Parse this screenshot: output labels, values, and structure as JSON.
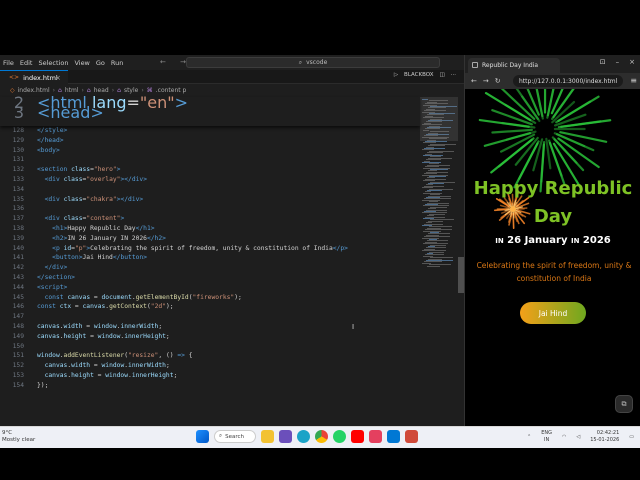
{
  "menu": [
    "File",
    "Edit",
    "Selection",
    "View",
    "Go",
    "Run"
  ],
  "nav_arrows": "← →",
  "command_center": {
    "text": "vscode"
  },
  "editor_tab": {
    "label": "index.html",
    "icon_text": "<>"
  },
  "editor_actions": {
    "run_label": "▷",
    "blackbox_label": "BLACKBOX",
    "split_label": "◫",
    "more_label": "···"
  },
  "breadcrumb": [
    "index.html",
    "html",
    "head",
    "style",
    ".content p"
  ],
  "code_lines": [
    {
      "n": "2",
      "html": "<span class='t-tag'>&lt;html</span> <span class='t-attr'>lang</span>=<span class='t-str'>\"en\"</span><span class='t-tag'>&gt;</span>"
    },
    {
      "n": "3",
      "html": "<span class='t-tag'>&lt;head&gt;</span>"
    },
    {
      "n": "128",
      "html": "<span class='t-tag'>&lt;/style&gt;</span>"
    },
    {
      "n": "129",
      "html": "<span class='t-tag'>&lt;/head&gt;</span>"
    },
    {
      "n": "130",
      "html": "<span class='t-tag'>&lt;body&gt;</span>"
    },
    {
      "n": "131",
      "html": ""
    },
    {
      "n": "132",
      "html": "<span class='t-tag'>&lt;section</span> <span class='t-attr'>class</span>=<span class='t-str'>\"hero\"</span><span class='t-tag'>&gt;</span>"
    },
    {
      "n": "133",
      "html": "  <span class='t-tag'>&lt;div</span> <span class='t-attr'>class</span>=<span class='t-str'>\"overlay\"</span><span class='t-tag'>&gt;&lt;/div&gt;</span>"
    },
    {
      "n": "134",
      "html": ""
    },
    {
      "n": "135",
      "html": "  <span class='t-tag'>&lt;div</span> <span class='t-attr'>class</span>=<span class='t-str'>\"chakra\"</span><span class='t-tag'>&gt;&lt;/div&gt;</span>"
    },
    {
      "n": "136",
      "html": ""
    },
    {
      "n": "137",
      "html": "  <span class='t-tag'>&lt;div</span> <span class='t-attr'>class</span>=<span class='t-str'>\"content\"</span><span class='t-tag'>&gt;</span>"
    },
    {
      "n": "138",
      "html": "    <span class='t-tag'>&lt;h1&gt;</span>Happy Republic Day<span class='t-tag'>&lt;/h1&gt;</span>"
    },
    {
      "n": "139",
      "html": "    <span class='t-tag'>&lt;h2&gt;</span>IN 26 January IN 2026<span class='t-tag'>&lt;/h2&gt;</span>"
    },
    {
      "n": "140",
      "html": "    <span class='t-tag'>&lt;p</span> <span class='t-attr'>id</span>=<span class='t-str'>\"p\"</span><span class='t-tag'>&gt;</span>Celebrating the spirit of freedom, unity &amp; constitution of India<span class='t-tag'>&lt;/p&gt;</span>"
    },
    {
      "n": "141",
      "html": "    <span class='t-tag'>&lt;button&gt;</span>Jai Hind<span class='t-tag'>&lt;/button&gt;</span>"
    },
    {
      "n": "142",
      "html": "  <span class='t-tag'>&lt;/div&gt;</span>"
    },
    {
      "n": "143",
      "html": "<span class='t-tag'>&lt;/section&gt;</span>"
    },
    {
      "n": "144",
      "html": "<span class='t-tag'>&lt;script&gt;</span>"
    },
    {
      "n": "145",
      "html": "  <span class='t-kw'>const</span> <span class='t-var'>canvas</span> = <span class='t-var'>document</span>.<span class='t-fn'>getElementById</span>(<span class='t-str'>\"fireworks\"</span>);"
    },
    {
      "n": "146",
      "html": "<span class='t-kw'>const</span> <span class='t-var'>ctx</span> = <span class='t-var'>canvas</span>.<span class='t-fn'>getContext</span>(<span class='t-str'>\"2d\"</span>);"
    },
    {
      "n": "147",
      "html": ""
    },
    {
      "n": "148",
      "html": "<span class='t-var'>canvas</span>.<span class='t-var'>width</span> = <span class='t-var'>window</span>.<span class='t-var'>innerWidth</span>;"
    },
    {
      "n": "149",
      "html": "<span class='t-var'>canvas</span>.<span class='t-var'>height</span> = <span class='t-var'>window</span>.<span class='t-var'>innerHeight</span>;"
    },
    {
      "n": "150",
      "html": ""
    },
    {
      "n": "151",
      "html": "<span class='t-var'>window</span>.<span class='t-fn'>addEventListener</span>(<span class='t-str'>\"resize\"</span>, () <span class='t-kw'>=&gt;</span> {"
    },
    {
      "n": "152",
      "html": "  <span class='t-var'>canvas</span>.<span class='t-var'>width</span> = <span class='t-var'>window</span>.<span class='t-var'>innerWidth</span>;"
    },
    {
      "n": "153",
      "html": "  <span class='t-var'>canvas</span>.<span class='t-var'>height</span> = <span class='t-var'>window</span>.<span class='t-var'>innerHeight</span>;"
    },
    {
      "n": "154",
      "html": "});"
    }
  ],
  "browser": {
    "tab_title": "Republic Day India",
    "url": "http://127.0.0.1:3000/index.html"
  },
  "hero": {
    "title_line1": "Happy Republic",
    "title_line2": "Day",
    "date_in1": "IN",
    "date_main": "26 January",
    "date_in2": "IN",
    "date_year": "2026",
    "subtitle": "Celebrating the spirit of freedom, unity & constitution of India",
    "button": "Jai Hind"
  },
  "taskbar": {
    "weather_temp": "9°C",
    "weather_desc": "Mostly clear",
    "search": "Search",
    "lang1": "ENG",
    "lang2": "IN",
    "time": "02:42:21",
    "date": "15-01-2026"
  },
  "colors": {
    "accent": "#0078d4",
    "hero_green": "#7ec225",
    "hero_orange": "#ff8c1a"
  }
}
